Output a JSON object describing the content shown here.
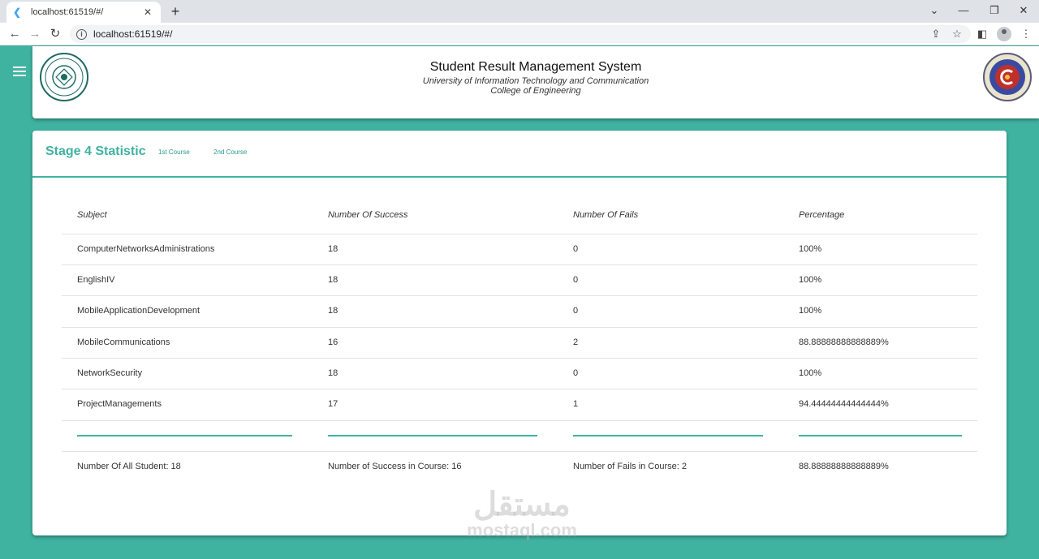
{
  "browser": {
    "tab_title": "localhost:61519/#/",
    "url": "localhost:61519/#/"
  },
  "header": {
    "title": "Student Result Management System",
    "subtitle": "University of Information Technology and Communication",
    "college": "College of Engineering"
  },
  "stage": {
    "title": "Stage 4 Statistic",
    "course_links": [
      "1st Course",
      "2nd Course"
    ]
  },
  "table": {
    "headers": [
      "Subject",
      "Number Of Success",
      "Number Of Fails",
      "Percentage"
    ],
    "rows": [
      [
        "ComputerNetworksAdministrations",
        "18",
        "0",
        "100%"
      ],
      [
        "EnglishIV",
        "18",
        "0",
        "100%"
      ],
      [
        "MobileApplicationDevelopment",
        "18",
        "0",
        "100%"
      ],
      [
        "MobileCommunications",
        "16",
        "2",
        "88.88888888888889%"
      ],
      [
        "NetworkSecurity",
        "18",
        "0",
        "100%"
      ],
      [
        "ProjectManagements",
        "17",
        "1",
        "94.44444444444444%"
      ]
    ],
    "summary": [
      "Number Of All Student: 18",
      "Number of Success in Course:  16",
      "Number of Fails in Course:  2",
      "88.88888888888889%"
    ]
  },
  "watermark": {
    "arabic": "مستقل",
    "latin": "mostaql.com"
  },
  "colors": {
    "accent": "#3fb3a0",
    "background": "#3fb3a0"
  }
}
